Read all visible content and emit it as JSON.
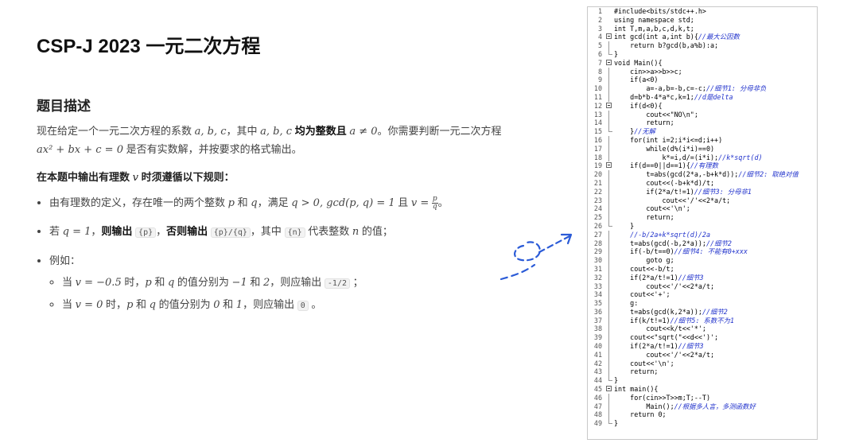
{
  "title": "CSP-J 2023 一元二次方程",
  "section_heading": "题目描述",
  "desc": {
    "p1": "现在给定一个一元二次方程的系数",
    "coeffs": "a, b, c",
    "p2": "，其中",
    "coeffs2": "a, b, c",
    "bold1": "均为整数且",
    "cond": "a ≠ 0",
    "p3": "。你需要判断一元二次方程",
    "equation": "ax² + bx + c = 0",
    "p4": "是否有实数解，并按要求的格式输出。"
  },
  "rule": {
    "a": "在本题中输出有理数",
    "v": "v",
    "b": "时须遵循以下规则："
  },
  "bullets": {
    "b1": {
      "a": "由有理数的定义，存在唯一的两个整数",
      "p": "p",
      "and": "和",
      "q": "q",
      "b": "，满足",
      "m1": "q > 0, gcd(p, q) = 1",
      "c": "且",
      "m2": "v =",
      "fn": "p",
      "fd": "q",
      "end": "。"
    },
    "b2": {
      "a": "若",
      "m1": "q = 1",
      "b": "，",
      "bold1": "则输出",
      "code1": "{p}",
      "c": "，",
      "bold2": "否则输出",
      "code2": "{p}/{q}",
      "d": "，其中",
      "code3": "{n}",
      "e": "代表整数",
      "n": "n",
      "f": "的值；"
    },
    "b3": "例如：",
    "sub1": {
      "a": "当",
      "m1": "v = −0.5",
      "b": "时，",
      "p": "p",
      "c": "和",
      "q": "q",
      "d": "的值分别为",
      "m2": "−1",
      "e": "和",
      "m3": "2",
      "f": "，则应输出",
      "code": "-1/2",
      "g": "；"
    },
    "sub2": {
      "a": "当",
      "m1": "v = 0",
      "b": "时，",
      "p": "p",
      "c": "和",
      "q": "q",
      "d": "的值分别为",
      "m2": "0",
      "e": "和",
      "m3": "1",
      "f": "，则应输出",
      "code": "0",
      "g": "。"
    }
  },
  "code": [
    {
      "n": "1",
      "fold": "",
      "c": "#include<bits/stdc++.h>",
      "cm": ""
    },
    {
      "n": "2",
      "fold": "",
      "c": "using namespace std;",
      "cm": ""
    },
    {
      "n": "3",
      "fold": "",
      "c": "int T,m,a,b,c,d,k,t;",
      "cm": ""
    },
    {
      "n": "4",
      "fold": "box",
      "c": "int gcd(int a,int b){",
      "cm": "//最大公因数"
    },
    {
      "n": "5",
      "fold": "bar",
      "c": "    return b?gcd(b,a%b):a;",
      "cm": ""
    },
    {
      "n": "6",
      "fold": "end",
      "c": "}",
      "cm": ""
    },
    {
      "n": "7",
      "fold": "box",
      "c": "void Main(){",
      "cm": ""
    },
    {
      "n": "8",
      "fold": "bar",
      "c": "    cin>>a>>b>>c;",
      "cm": ""
    },
    {
      "n": "9",
      "fold": "bar",
      "c": "    if(a<0)",
      "cm": ""
    },
    {
      "n": "10",
      "fold": "bar",
      "c": "        a=-a,b=-b,c=-c;",
      "cm": "//细节1: 分母非负"
    },
    {
      "n": "11",
      "fold": "bar",
      "c": "    d=b*b-4*a*c,k=1;",
      "cm": "//d是delta"
    },
    {
      "n": "12",
      "fold": "box",
      "c": "    if(d<0){",
      "cm": ""
    },
    {
      "n": "13",
      "fold": "bar",
      "c": "        cout<<\"NO\\n\";",
      "cm": ""
    },
    {
      "n": "14",
      "fold": "bar",
      "c": "        return;",
      "cm": ""
    },
    {
      "n": "15",
      "fold": "end",
      "c": "    }",
      "cm": "//无解"
    },
    {
      "n": "16",
      "fold": "bar",
      "c": "    for(int i=2;i*i<=d;i++)",
      "cm": ""
    },
    {
      "n": "17",
      "fold": "bar",
      "c": "        while(d%(i*i)==0)",
      "cm": ""
    },
    {
      "n": "18",
      "fold": "bar",
      "c": "            k*=i,d/=(i*i);",
      "cm": "//k*sqrt(d)"
    },
    {
      "n": "19",
      "fold": "box",
      "c": "    if(d==0||d==1){",
      "cm": "//有理数"
    },
    {
      "n": "20",
      "fold": "bar",
      "c": "        t=abs(gcd(2*a,-b+k*d));",
      "cm": "//细节2: 取绝对值"
    },
    {
      "n": "21",
      "fold": "bar",
      "c": "        cout<<(-b+k*d)/t;",
      "cm": ""
    },
    {
      "n": "22",
      "fold": "bar",
      "c": "        if(2*a/t!=1)",
      "cm": "//细节3: 分母非1"
    },
    {
      "n": "23",
      "fold": "bar",
      "c": "            cout<<'/'<<2*a/t;",
      "cm": ""
    },
    {
      "n": "24",
      "fold": "bar",
      "c": "        cout<<'\\n';",
      "cm": ""
    },
    {
      "n": "25",
      "fold": "bar",
      "c": "        return;",
      "cm": ""
    },
    {
      "n": "26",
      "fold": "end",
      "c": "    }",
      "cm": ""
    },
    {
      "n": "27",
      "fold": "bar",
      "c": "    ",
      "cm": "//-b/2a+k*sqrt(d)/2a"
    },
    {
      "n": "28",
      "fold": "bar",
      "c": "    t=abs(gcd(-b,2*a));",
      "cm": "//细节2"
    },
    {
      "n": "29",
      "fold": "bar",
      "c": "    if(-b/t==0)",
      "cm": "//细节4: 不能有0+xxx"
    },
    {
      "n": "30",
      "fold": "bar",
      "c": "        goto g;",
      "cm": ""
    },
    {
      "n": "31",
      "fold": "bar",
      "c": "    cout<<-b/t;",
      "cm": ""
    },
    {
      "n": "32",
      "fold": "bar",
      "c": "    if(2*a/t!=1)",
      "cm": "//细节3"
    },
    {
      "n": "33",
      "fold": "bar",
      "c": "        cout<<'/'<<2*a/t;",
      "cm": ""
    },
    {
      "n": "34",
      "fold": "bar",
      "c": "    cout<<'+';",
      "cm": ""
    },
    {
      "n": "35",
      "fold": "bar",
      "c": "    g:",
      "cm": ""
    },
    {
      "n": "36",
      "fold": "bar",
      "c": "    t=abs(gcd(k,2*a));",
      "cm": "//细节2"
    },
    {
      "n": "37",
      "fold": "bar",
      "c": "    if(k/t!=1)",
      "cm": "//细节5: 系数不为1"
    },
    {
      "n": "38",
      "fold": "bar",
      "c": "        cout<<k/t<<'*';",
      "cm": ""
    },
    {
      "n": "39",
      "fold": "bar",
      "c": "    cout<<\"sqrt(\"<<d<<')';",
      "cm": ""
    },
    {
      "n": "40",
      "fold": "bar",
      "c": "    if(2*a/t!=1)",
      "cm": "//细节3"
    },
    {
      "n": "41",
      "fold": "bar",
      "c": "        cout<<'/'<<2*a/t;",
      "cm": ""
    },
    {
      "n": "42",
      "fold": "bar",
      "c": "    cout<<'\\n';",
      "cm": ""
    },
    {
      "n": "43",
      "fold": "bar",
      "c": "    return;",
      "cm": ""
    },
    {
      "n": "44",
      "fold": "end",
      "c": "}",
      "cm": ""
    },
    {
      "n": "45",
      "fold": "box",
      "c": "int main(){",
      "cm": ""
    },
    {
      "n": "46",
      "fold": "bar",
      "c": "    for(cin>>T>>m;T;--T)",
      "cm": ""
    },
    {
      "n": "47",
      "fold": "bar",
      "c": "        Main();",
      "cm": "//根据多人言，多测函数好"
    },
    {
      "n": "48",
      "fold": "bar",
      "c": "    return 0;",
      "cm": ""
    },
    {
      "n": "49",
      "fold": "end",
      "c": "}",
      "cm": ""
    }
  ],
  "colors": {
    "comment": "#2233cc",
    "string": "#a31515",
    "sketch": "#2b5bd7"
  }
}
